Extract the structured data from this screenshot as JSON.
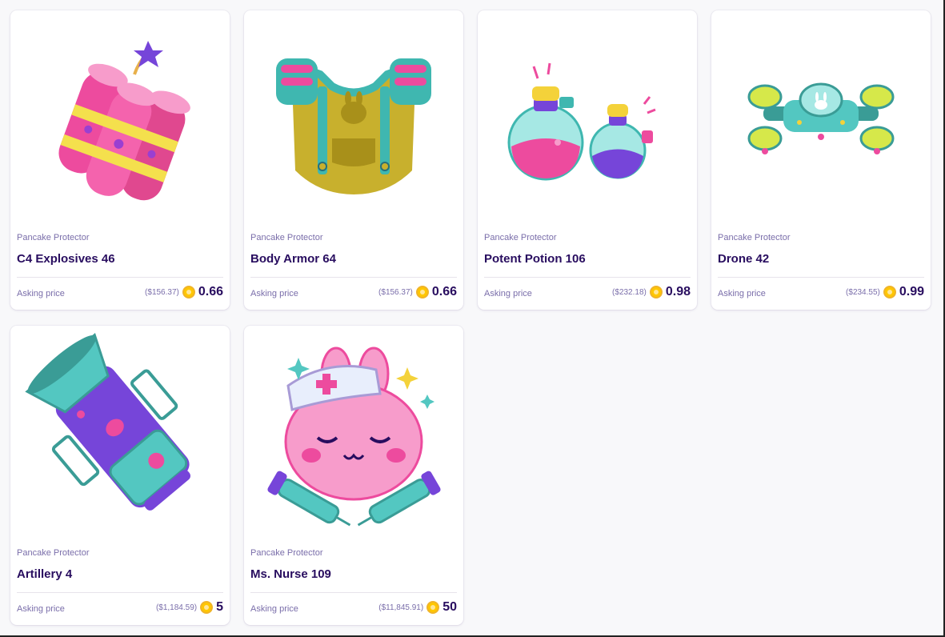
{
  "cards": [
    {
      "collection": "Pancake Protector",
      "name": "C4 Explosives 46",
      "asking_label": "Asking price",
      "usd": "($156.37)",
      "price": "0.66",
      "icon": "c4-explosives-icon"
    },
    {
      "collection": "Pancake Protector",
      "name": "Body Armor 64",
      "asking_label": "Asking price",
      "usd": "($156.37)",
      "price": "0.66",
      "icon": "body-armor-icon"
    },
    {
      "collection": "Pancake Protector",
      "name": "Potent Potion 106",
      "asking_label": "Asking price",
      "usd": "($232.18)",
      "price": "0.98",
      "icon": "potion-icon"
    },
    {
      "collection": "Pancake Protector",
      "name": "Drone 42",
      "asking_label": "Asking price",
      "usd": "($234.55)",
      "price": "0.99",
      "icon": "drone-icon"
    },
    {
      "collection": "Pancake Protector",
      "name": "Artillery 4",
      "asking_label": "Asking price",
      "usd": "($1,184.59)",
      "price": "5",
      "icon": "artillery-icon"
    },
    {
      "collection": "Pancake Protector",
      "name": "Ms. Nurse 109",
      "asking_label": "Asking price",
      "usd": "($11,845.91)",
      "price": "50",
      "icon": "nurse-bunny-icon"
    }
  ],
  "colors": {
    "text_primary": "#280d5f",
    "text_secondary": "#7a6eaa",
    "coin": "#ffc700",
    "pink": "#ed4b9e",
    "teal": "#53c7c1",
    "purple": "#7645d9"
  }
}
